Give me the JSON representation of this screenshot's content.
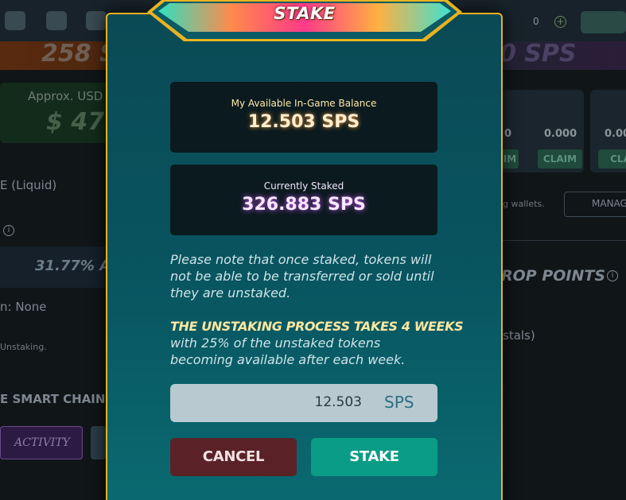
{
  "background": {
    "balance_fragment": "258 S",
    "right_fragment": "0 SPS",
    "approx_label": "Approx. USD V",
    "usd_fragment": "$ 47.",
    "liquid_label": "E (Liquid)",
    "apr_fragment": "31.77% A",
    "none_label": "n:   None",
    "unstaking_label": "Unstaking.",
    "chain_label": "E SMART CHAIN",
    "activity_label": "ACTIVITY",
    "counter_value": "0",
    "plus_label": "+",
    "claim_label_1": "IM",
    "claim_label_2": "CLAIM",
    "claim_label_3": "CLA",
    "zero_1": "0",
    "zero_2": "0.000",
    "zero_3": "0.00",
    "wallets_label": "g wallets.",
    "manage_label": "MANAG",
    "drop_points_label": "ROP POINTS",
    "stals_label": "stals)",
    "info_glyph": "i"
  },
  "modal": {
    "title": "STAKE",
    "balance_label": "My Available In-Game Balance",
    "balance_value": "12.503 SPS",
    "staked_label": "Currently Staked",
    "staked_value": "326.883 SPS",
    "note": "Please note that once staked, tokens will not be able to be transferred or sold until they are unstaked.",
    "warning_heading": "THE UNSTAKING PROCESS TAKES 4 WEEKS",
    "warning_body": "with 25% of the unstaked tokens becoming available after each week.",
    "amount_value": "12.503",
    "amount_unit": "SPS",
    "cancel_label": "CANCEL",
    "stake_label": "STAKE"
  },
  "colors": {
    "modal_border": "#e8b320",
    "cancel_bg": "#5a2227",
    "stake_bg": "#0b9c86",
    "balance_glow": "#ffaa3c",
    "staked_glow": "#d25aff"
  }
}
